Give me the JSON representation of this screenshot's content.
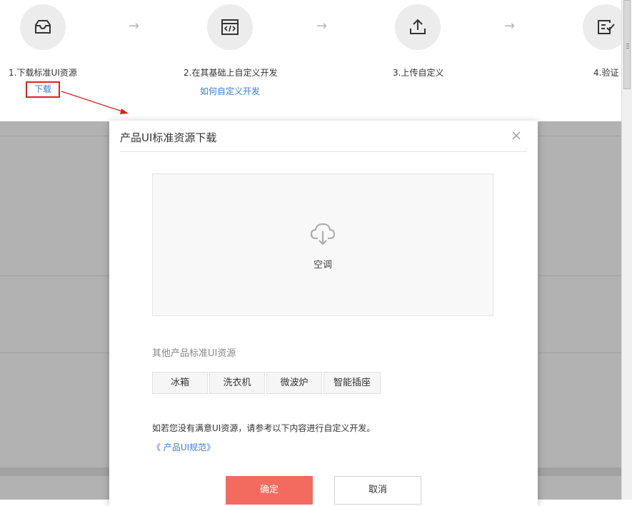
{
  "steps": [
    {
      "label": "1.下载标准UI资源",
      "icon": "inbox-icon"
    },
    {
      "label": "2.在其基础上自定义开发",
      "link": "如何自定义开发",
      "icon": "code-window-icon"
    },
    {
      "label": "3.上传自定义",
      "icon": "upload-icon"
    },
    {
      "label": "4.验证",
      "icon": "checklist-icon"
    }
  ],
  "download_link": "下载",
  "step_arrow": "→",
  "modal": {
    "title": "产品UI标准资源下载",
    "preview_name": "空调",
    "other_label": "其他产品标准UI资源",
    "chips": [
      "冰箱",
      "洗衣机",
      "微波炉",
      "智能插座"
    ],
    "hint": "如若您没有满意UI资源，请参考以下内容进行自定义开发。",
    "spec_link": "《 产品UI规范》",
    "confirm": "确定",
    "cancel": "取消"
  },
  "colors": {
    "accent": "#f36b5f",
    "link": "#3a7bd5",
    "highlight": "#e02020"
  }
}
